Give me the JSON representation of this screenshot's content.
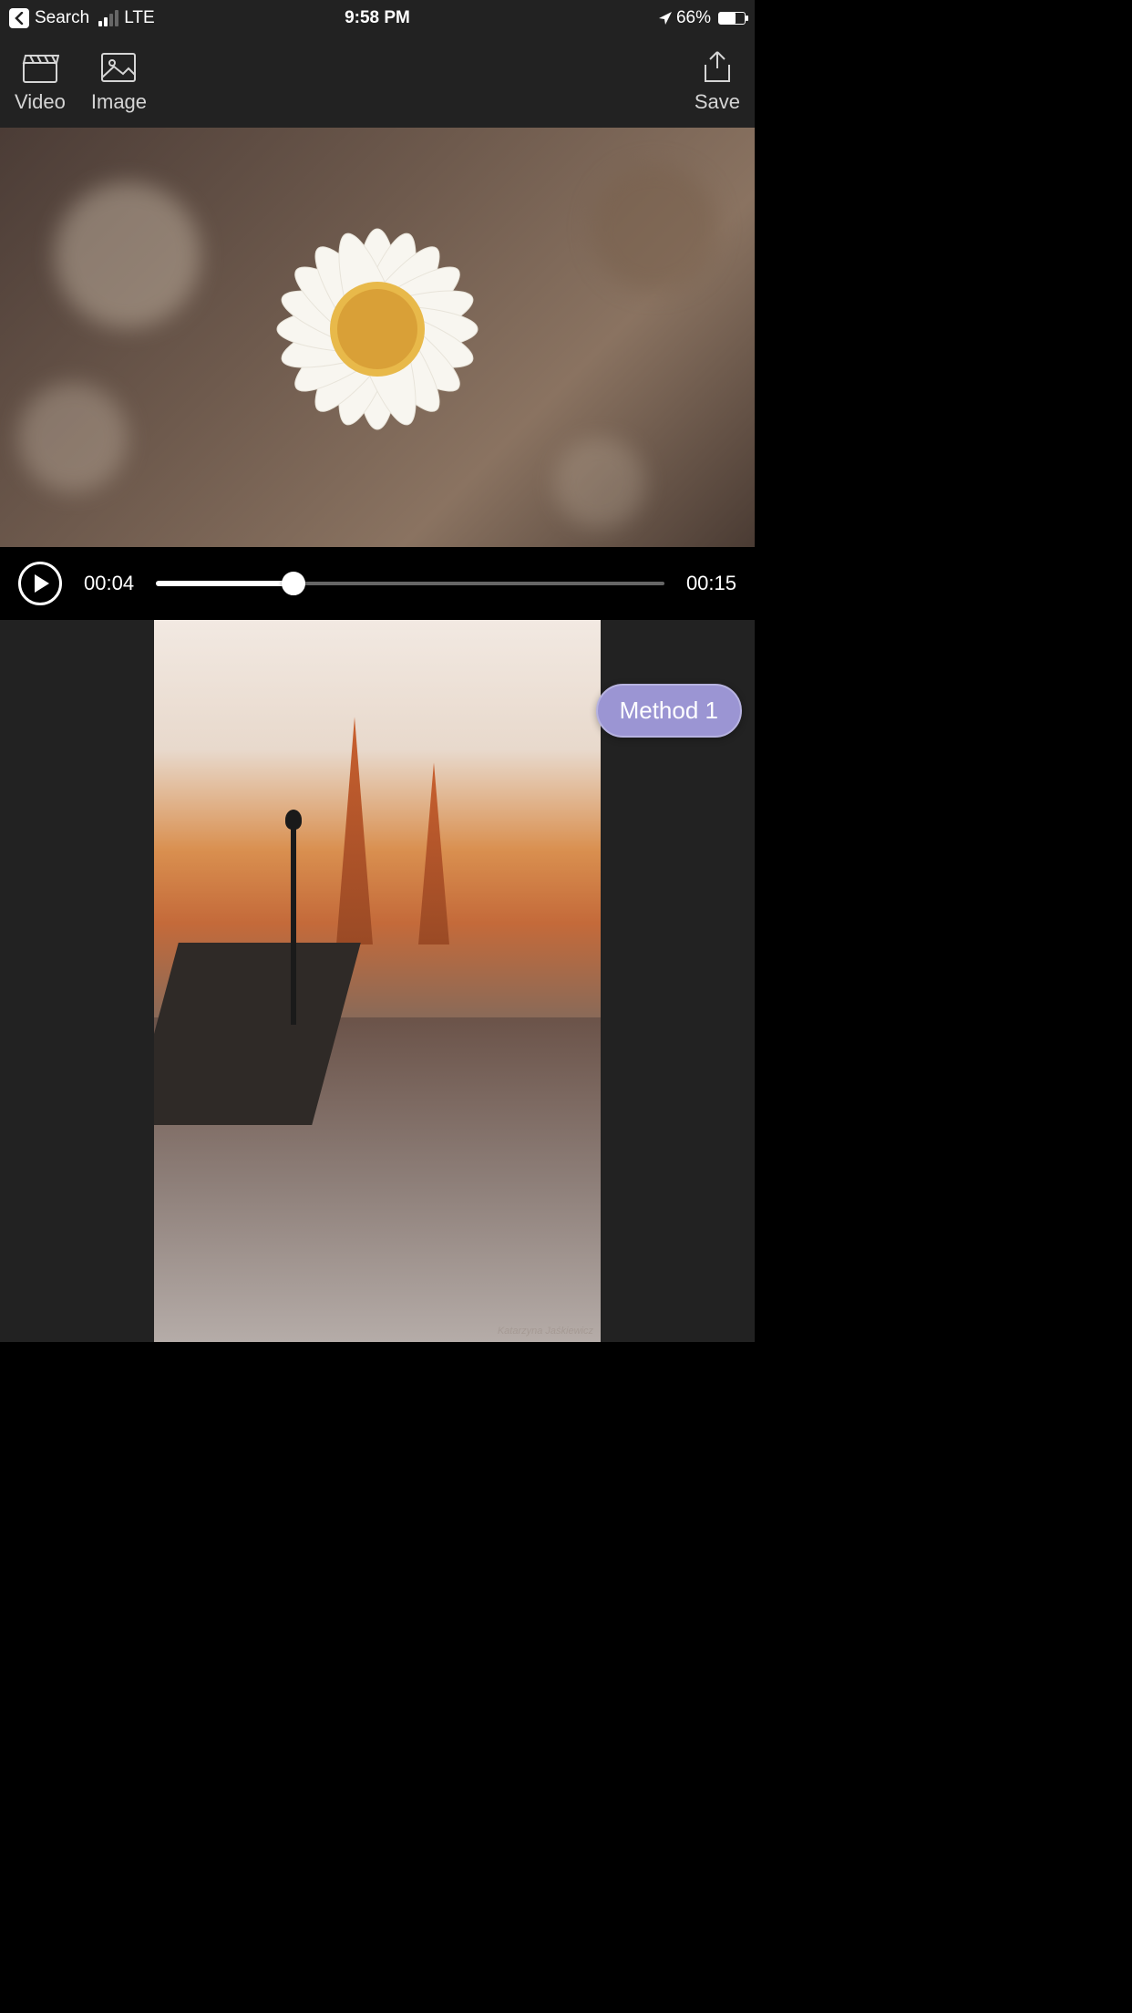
{
  "status": {
    "back_label": "Search",
    "carrier": "LTE",
    "time": "9:58 PM",
    "battery_pct": "66%"
  },
  "toolbar": {
    "video_label": "Video",
    "image_label": "Image",
    "save_label": "Save"
  },
  "playback": {
    "current_time": "00:04",
    "total_time": "00:15",
    "progress_pct": 27
  },
  "overlay": {
    "method_label": "Method 1"
  },
  "image": {
    "artist_credit": "Katarzyna Jaśkiewicz"
  }
}
